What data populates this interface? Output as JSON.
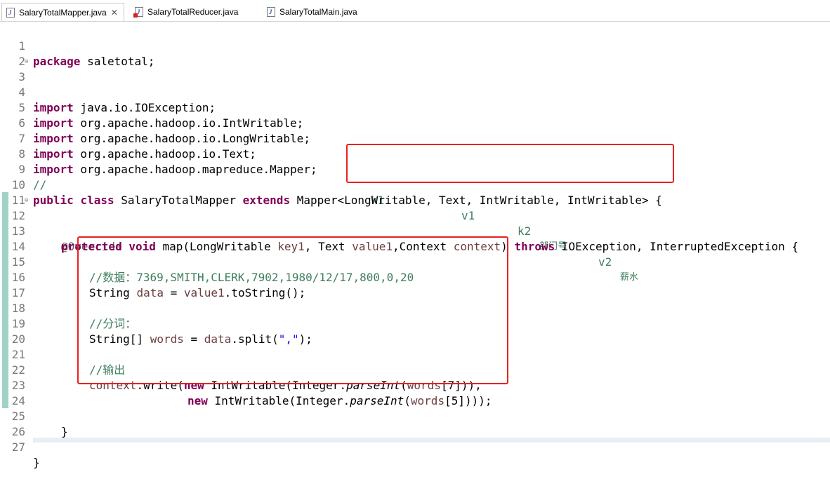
{
  "tabs": [
    {
      "label": "SalaryTotalMapper.java",
      "active": true,
      "close": "✕"
    },
    {
      "label": "SalaryTotalReducer.java",
      "active": false
    },
    {
      "label": "SalaryTotalMain.java",
      "active": false
    }
  ],
  "lines": {
    "l1": {
      "num": "1",
      "kw": "package",
      "rest": " saletotal;"
    },
    "l2": {
      "num": "2"
    },
    "l3": {
      "num": "3",
      "kw": "import",
      "rest": " java.io.IOException;"
    },
    "l4": {
      "num": "4"
    },
    "l5": {
      "num": "5",
      "kw": "import",
      "rest": " org.apache.hadoop.io.IntWritable;"
    },
    "l6": {
      "num": "6",
      "kw": "import",
      "rest": " org.apache.hadoop.io.LongWritable;"
    },
    "l7": {
      "num": "7",
      "kw": "import",
      "rest": " org.apache.hadoop.io.Text;"
    },
    "l8": {
      "num": "8",
      "kw": "import",
      "rest": " org.apache.hadoop.mapreduce.Mapper;"
    },
    "l9": {
      "num": "9",
      "comment": "//",
      "k1": "k1",
      "v1": "v1",
      "k2": "k2",
      "k2cn": "部门号",
      "v2": "v2",
      "v2cn": "薪水"
    },
    "l10": {
      "num": "10",
      "kw1": "public",
      "kw2": "class",
      "name": " SalaryTotalMapper ",
      "kw3": "extends",
      "rest": " Mapper<LongWritable, Text, IntWritable, IntWritable> {"
    },
    "l11": {
      "num": "11"
    },
    "l12": {
      "num": "12",
      "ann": "@Override"
    },
    "l13": {
      "num": "13",
      "kw1": "protected",
      "kw2": "void",
      "a": " map(LongWritable ",
      "p1": "key1",
      "b": ", Text ",
      "p2": "value1",
      "c": ",Context ",
      "p3": "context",
      "d": ") ",
      "kw3": "throws",
      "e": " IOException, InterruptedException {"
    },
    "l14": {
      "num": "14"
    },
    "l15": {
      "num": "15",
      "comment": "//数据：7369,SMITH,CLERK,7902,1980/12/17,800,0,20"
    },
    "l16": {
      "num": "16",
      "a": "String ",
      "v": "data",
      "b": " = ",
      "v2": "value1",
      "c": ".toString();"
    },
    "l17": {
      "num": "17"
    },
    "l18": {
      "num": "18",
      "comment": "//分词："
    },
    "l19": {
      "num": "19",
      "a": "String[] ",
      "v": "words",
      "b": " = ",
      "v2": "data",
      "c": ".split(",
      "s": "\",\"",
      "d": ");"
    },
    "l20": {
      "num": "20"
    },
    "l21": {
      "num": "21",
      "comment": "//输出"
    },
    "l22": {
      "num": "22",
      "v": "context",
      "a": ".write(",
      "kw": "new",
      "b": " IntWritable(Integer.",
      "m": "parseInt",
      "c": "(",
      "v2": "words",
      "d": "[7])),"
    },
    "l23": {
      "num": "23",
      "kw": "new",
      "b": " IntWritable(Integer.",
      "m": "parseInt",
      "c": "(",
      "v2": "words",
      "d": "[5])));"
    },
    "l24": {
      "num": "24"
    },
    "l25": {
      "num": "25",
      "rest": "}"
    },
    "l26": {
      "num": "26"
    },
    "l27": {
      "num": "27",
      "rest": "}"
    }
  },
  "fold_icon": "⊖",
  "colors": {
    "keyword": "#7f0055",
    "comment": "#3f7f5f",
    "variable": "#6a3e3e",
    "string": "#2a00ff",
    "highlight_box": "#e8221e"
  }
}
